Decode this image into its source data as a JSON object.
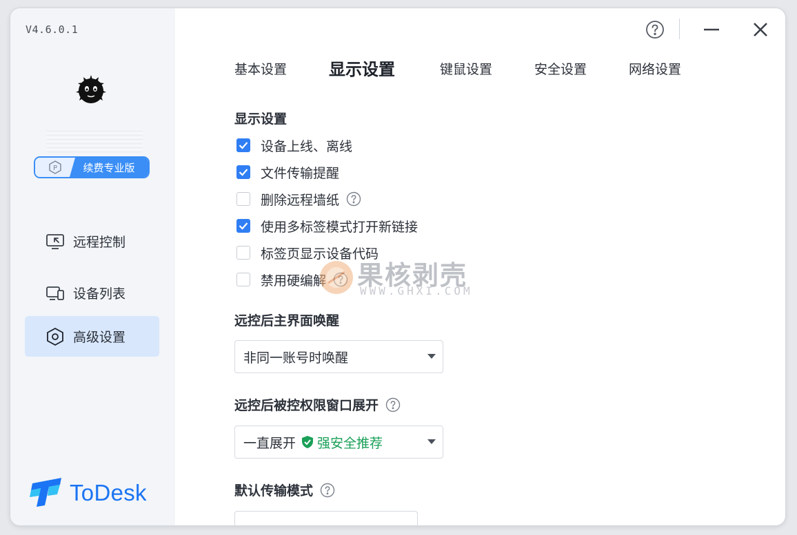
{
  "app": {
    "version": "V4.6.0.1",
    "brand_name": "ToDesk",
    "brand_color": "#1b74f3",
    "accent_color": "#2f7ef4"
  },
  "sidebar": {
    "renew_label": "续费专业版",
    "items": [
      {
        "label": "远程控制",
        "icon": "monitor-remote-icon",
        "active": false
      },
      {
        "label": "设备列表",
        "icon": "devices-icon",
        "active": false
      },
      {
        "label": "高级设置",
        "icon": "hex-gear-icon",
        "active": true
      }
    ]
  },
  "titlebar": {
    "help_icon": "help-circle-icon",
    "minimize_icon": "minimize-icon",
    "close_icon": "close-icon"
  },
  "tabs": [
    {
      "label": "基本设置",
      "active": false
    },
    {
      "label": "显示设置",
      "active": true
    },
    {
      "label": "键鼠设置",
      "active": false
    },
    {
      "label": "安全设置",
      "active": false
    },
    {
      "label": "网络设置",
      "active": false
    }
  ],
  "display_settings": {
    "section_title": "显示设置",
    "options": [
      {
        "label": "设备上线、离线",
        "checked": true,
        "help": false
      },
      {
        "label": "文件传输提醒",
        "checked": true,
        "help": false
      },
      {
        "label": "删除远程墙纸",
        "checked": false,
        "help": true
      },
      {
        "label": "使用多标签模式打开新链接",
        "checked": true,
        "help": false
      },
      {
        "label": "标签页显示设备代码",
        "checked": false,
        "help": false
      },
      {
        "label": "禁用硬编解",
        "checked": false,
        "help": true
      }
    ]
  },
  "wake_main": {
    "title": "远控后主界面唤醒",
    "selected": "非同一账号时唤醒"
  },
  "expand_window": {
    "title": "远控后被控权限窗口展开",
    "selected": "一直展开",
    "safe_tag": "强安全推荐",
    "safe_color": "#1aa058"
  },
  "transfer_mode": {
    "title": "默认传输模式"
  },
  "watermark": {
    "cn": "果核剥壳",
    "en": "WWW.GHXI.COM"
  }
}
